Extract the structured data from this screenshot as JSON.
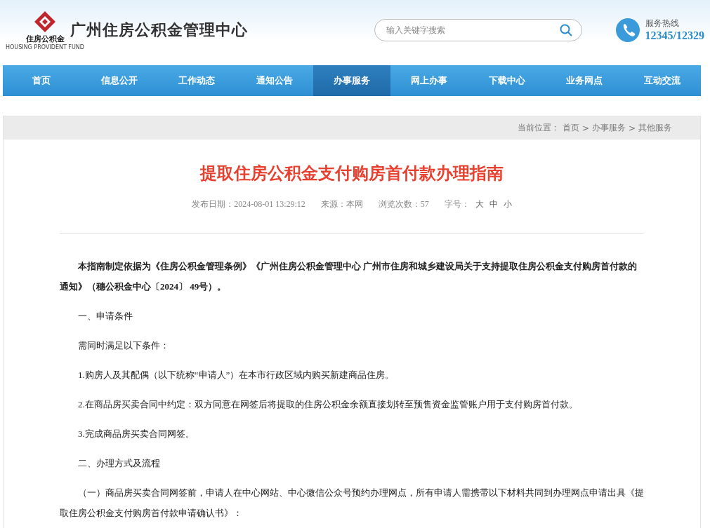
{
  "header": {
    "logo_text": "住房公积金",
    "logo_subtext": "HOUSING PROVIDENT FUND",
    "site_title": "广州住房公积金管理中心",
    "search": {
      "placeholder": "输入关键字搜索"
    },
    "hotline": {
      "label": "服务热线",
      "number": "12345/12329"
    }
  },
  "nav": [
    {
      "label": "首页",
      "selected": false
    },
    {
      "label": "信息公开",
      "selected": false
    },
    {
      "label": "工作动态",
      "selected": false
    },
    {
      "label": "通知公告",
      "selected": false
    },
    {
      "label": "办事服务",
      "selected": true
    },
    {
      "label": "网上办事",
      "selected": false
    },
    {
      "label": "下载中心",
      "selected": false
    },
    {
      "label": "业务网点",
      "selected": false
    },
    {
      "label": "互动交流",
      "selected": false
    }
  ],
  "breadcrumb": {
    "label": "当前位置：",
    "items": [
      "首页",
      "办事服务",
      "其他服务"
    ],
    "separator": ">"
  },
  "article": {
    "title": "提取住房公积金支付购房首付款办理指南",
    "meta": [
      {
        "label": "发布日期：",
        "value": "2024-08-01 13:29:12"
      },
      {
        "label": "来源：",
        "value": "本网"
      },
      {
        "label": "浏览次数：",
        "value": "57"
      }
    ],
    "font_size": {
      "label": "字号：",
      "options": [
        "大",
        "中",
        "小"
      ]
    },
    "paragraphs": [
      {
        "text": "本指南制定依据为《住房公积金管理条例》《广州住房公积金管理中心 广州市住房和城乡建设局关于支持提取住房公积金支付购房首付款的通知》（穗公积金中心〔2024〕 49号）。",
        "bold": true
      },
      {
        "text": "一、申请条件",
        "bold": false
      },
      {
        "text": "需同时满足以下条件：",
        "bold": false
      },
      {
        "text": "1.购房人及其配偶（以下统称“申请人”）在本市行政区域内购买新建商品住房。",
        "bold": false
      },
      {
        "text": "2.在商品房买卖合同中约定：双方同意在网签后将提取的住房公积金余额直接划转至预售资金监管账户用于支付购房首付款。",
        "bold": false
      },
      {
        "text": "3.完成商品房买卖合同网签。",
        "bold": false
      },
      {
        "text": "二、办理方式及流程",
        "bold": false
      },
      {
        "text": "（一）商品房买卖合同网签前，申请人在中心网站、中心微信公众号预约办理网点，所有申请人需携带以下材料共同到办理网点申请出具《提取住房公积金支付购房首付款申请确认书》：",
        "bold": false
      }
    ]
  }
}
